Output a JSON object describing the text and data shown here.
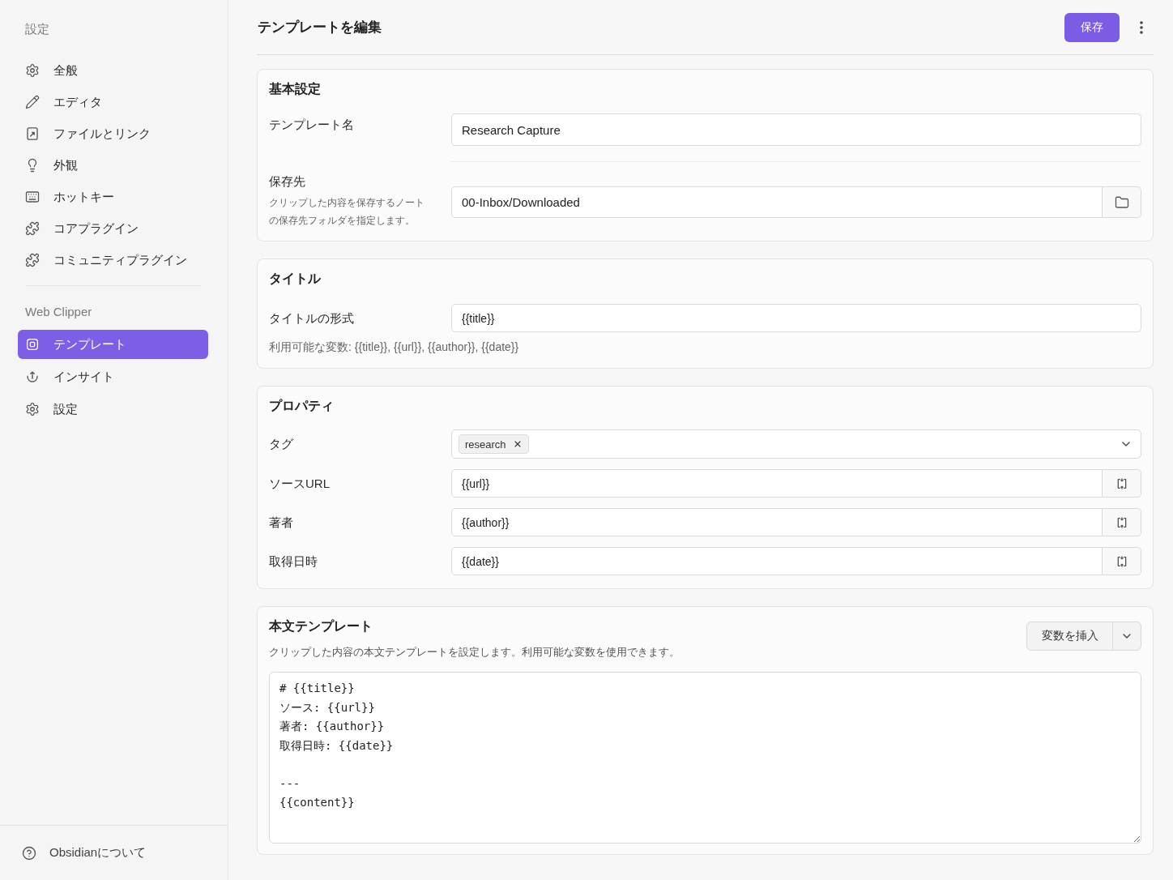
{
  "sidebar": {
    "heading": "設定",
    "items": [
      {
        "label": "全般",
        "selected": false
      },
      {
        "label": "エディタ",
        "selected": false
      },
      {
        "label": "ファイルとリンク",
        "selected": false
      },
      {
        "label": "外観",
        "selected": false
      },
      {
        "label": "ホットキー",
        "selected": false
      },
      {
        "label": "コアプラグイン",
        "selected": false
      },
      {
        "label": "コミュニティプラグイン",
        "selected": false
      }
    ],
    "section": {
      "heading": "Web Clipper",
      "items": [
        {
          "label": "テンプレート",
          "selected": true
        },
        {
          "label": "インサイト",
          "selected": false
        },
        {
          "label": "設定",
          "selected": false
        }
      ]
    },
    "footer_link": "Obsidianについて"
  },
  "header": {
    "title": "テンプレートを編集",
    "save_button": "保存"
  },
  "basic_settings": {
    "title": "基本設定",
    "template_name": {
      "label": "テンプレート名",
      "value": "Research Capture"
    },
    "location": {
      "label": "保存先",
      "description": "クリップした内容を保存するノートの保存先フォルダを指定します。",
      "value": "00-Inbox/Downloaded"
    }
  },
  "title_settings": {
    "title": "タイトル",
    "format": {
      "label": "タイトルの形式",
      "value": "{{title}}"
    },
    "help": "利用可能な変数: {{title}}, {{url}}, {{author}}, {{date}}"
  },
  "properties": {
    "title": "プロパティ",
    "rows": [
      {
        "kind": "tags",
        "label": "タグ",
        "tags": [
          "research"
        ]
      },
      {
        "kind": "variable",
        "label": "ソースURL",
        "value": "{{url}}"
      },
      {
        "kind": "variable",
        "label": "著者",
        "value": "{{author}}"
      },
      {
        "kind": "variable",
        "label": "取得日時",
        "value": "{{date}}"
      }
    ]
  },
  "body_template": {
    "title": "本文テンプレート",
    "description": "クリップした内容の本文テンプレートを設定します。利用可能な変数を使用できます。",
    "insert_button": "変数を挿入",
    "content": "# {{title}}\nソース: {{url}}\n著者: {{author}}\n取得日時: {{date}}\n\n---\n{{content}}"
  }
}
